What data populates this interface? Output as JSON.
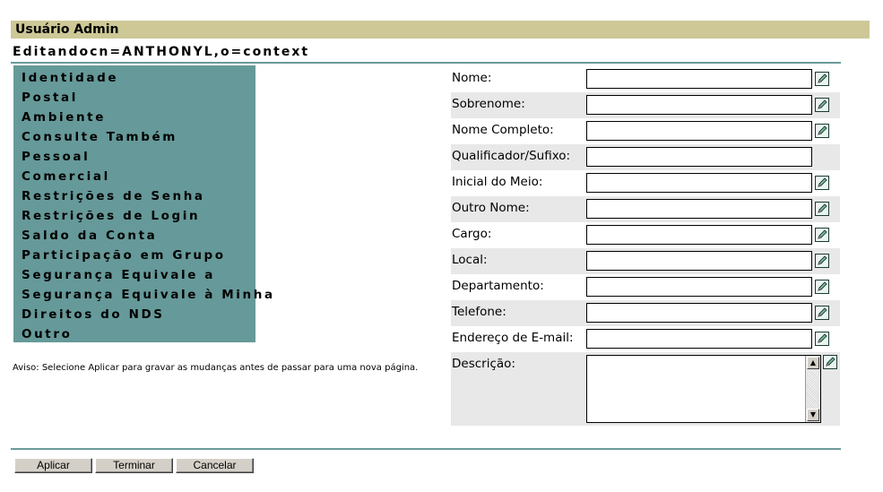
{
  "header": {
    "title": "Usuário Admin",
    "subtitle": "Editandocn=ANTHONYL,o=context"
  },
  "nav": {
    "items": [
      "Identidade",
      "Postal",
      "Ambiente",
      "Consulte Também",
      "Pessoal",
      "Comercial",
      "Restrições de Senha",
      "Restrições de Login",
      "Saldo da Conta",
      "Participação em Grupo",
      "Segurança Equivale a",
      "Segurança Equivale à Minha",
      "Direitos do NDS",
      "Outro"
    ]
  },
  "warning": "Aviso: Selecione Aplicar para gravar as mudanças antes de passar para uma nova página.",
  "form": {
    "fields": [
      {
        "label": "Nome:",
        "value": "",
        "edit_icon": true
      },
      {
        "label": "Sobrenome:",
        "value": "",
        "edit_icon": true
      },
      {
        "label": "Nome Completo:",
        "value": "",
        "edit_icon": true
      },
      {
        "label": "Qualificador/Sufixo:",
        "value": "",
        "edit_icon": false
      },
      {
        "label": "Inicial do Meio:",
        "value": "",
        "edit_icon": true
      },
      {
        "label": "Outro Nome:",
        "value": "",
        "edit_icon": true
      },
      {
        "label": "Cargo:",
        "value": "",
        "edit_icon": true
      },
      {
        "label": "Local:",
        "value": "",
        "edit_icon": true
      },
      {
        "label": "Departamento:",
        "value": "",
        "edit_icon": true
      },
      {
        "label": "Telefone:",
        "value": "",
        "edit_icon": true
      },
      {
        "label": "Endereço de E-mail:",
        "value": "",
        "edit_icon": true
      }
    ],
    "description": {
      "label": "Descrição:",
      "value": ""
    }
  },
  "buttons": {
    "apply": "Aplicar",
    "finish": "Terminar",
    "cancel": "Cancelar"
  },
  "colors": {
    "title_bar": "#cdc896",
    "nav_panel": "#669999",
    "rule": "#6b9a9a",
    "row_shade": "#e8e8e8"
  }
}
